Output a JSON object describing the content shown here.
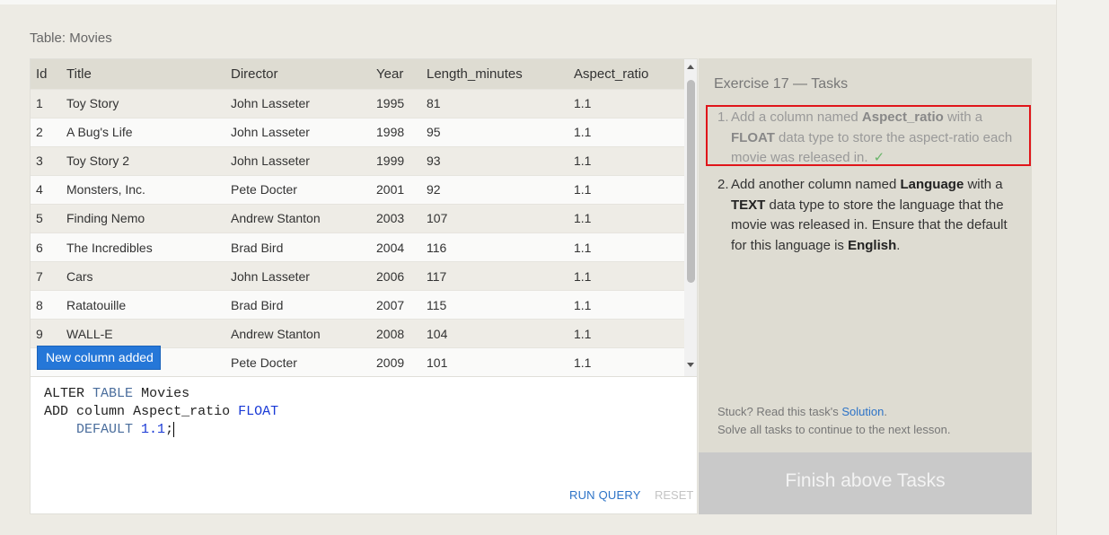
{
  "table": {
    "caption": "Table: Movies",
    "columns": [
      "Id",
      "Title",
      "Director",
      "Year",
      "Length_minutes",
      "Aspect_ratio"
    ],
    "rows": [
      [
        "1",
        "Toy Story",
        "John Lasseter",
        "1995",
        "81",
        "1.1"
      ],
      [
        "2",
        "A Bug's Life",
        "John Lasseter",
        "1998",
        "95",
        "1.1"
      ],
      [
        "3",
        "Toy Story 2",
        "John Lasseter",
        "1999",
        "93",
        "1.1"
      ],
      [
        "4",
        "Monsters, Inc.",
        "Pete Docter",
        "2001",
        "92",
        "1.1"
      ],
      [
        "5",
        "Finding Nemo",
        "Andrew Stanton",
        "2003",
        "107",
        "1.1"
      ],
      [
        "6",
        "The Incredibles",
        "Brad Bird",
        "2004",
        "116",
        "1.1"
      ],
      [
        "7",
        "Cars",
        "John Lasseter",
        "2006",
        "117",
        "1.1"
      ],
      [
        "8",
        "Ratatouille",
        "Brad Bird",
        "2007",
        "115",
        "1.1"
      ],
      [
        "9",
        "WALL-E",
        "Andrew Stanton",
        "2008",
        "104",
        "1.1"
      ],
      [
        "",
        "",
        "Pete Docter",
        "2009",
        "101",
        "1.1"
      ]
    ]
  },
  "toast": {
    "text": "New column added"
  },
  "editor": {
    "line1_kw1": "ALTER",
    "line1_kw2": "TABLE",
    "line1_name": "Movies",
    "line2_kw1": "ADD",
    "line2_kw2": "column",
    "line2_name": "Aspect_ratio",
    "line2_type": "FLOAT",
    "line3_kw": "DEFAULT",
    "line3_val": "1.1",
    "line3_end": ";",
    "run_label": "RUN QUERY",
    "reset_label": "RESET"
  },
  "tasks": {
    "title": "Exercise 17 — Tasks",
    "task1": {
      "num": "1.",
      "pre": "Add a column named ",
      "b1": "Aspect_ratio",
      "mid": " with a ",
      "b2": "FLOAT",
      "post": " data type to store the aspect-ratio each movie was released in.",
      "check": "✓"
    },
    "task2": {
      "num": "2.",
      "pre": "Add another column named ",
      "b1": "Language",
      "mid": " with a ",
      "b2": "TEXT",
      "post": " data type to store the language that the movie was released in. Ensure that the default for this language is ",
      "b3": "English",
      "end": "."
    },
    "stuck_pre": "Stuck? Read this task's ",
    "stuck_link": "Solution",
    "stuck_post": ".",
    "solve_all": "Solve all tasks to continue to the next lesson.",
    "finish_label": "Finish above Tasks"
  },
  "colors": {
    "accent": "#2d73c7",
    "toast_bg": "#2577d8",
    "highlight_border": "#e0151a",
    "check": "#6ab56a"
  }
}
